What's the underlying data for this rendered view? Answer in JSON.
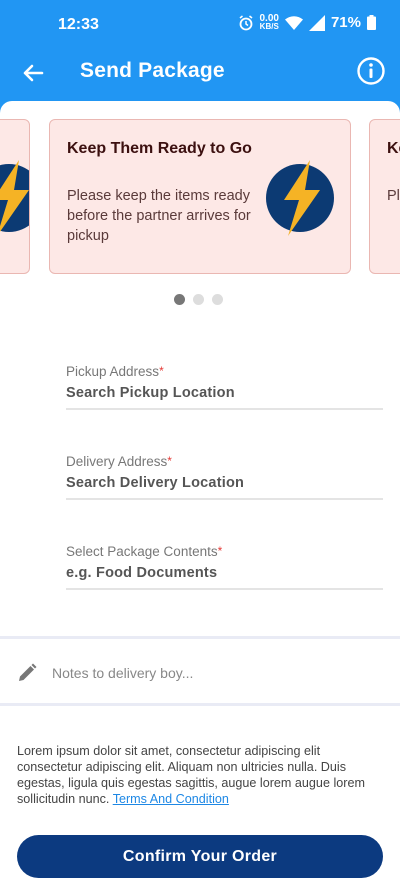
{
  "status_bar": {
    "time": "12:33",
    "speed_value": "0.00",
    "speed_unit": "KB/S",
    "battery": "71%"
  },
  "app_bar": {
    "title": "Send Package"
  },
  "carousel": {
    "cards": [
      {
        "title": "Keep Them Ready to Go",
        "text": "Please keep the items ready before the partner arrives for pickup"
      },
      {
        "title": "Ke Go",
        "text": "Pl re ar"
      }
    ],
    "active_dot": 0,
    "dot_count": 3
  },
  "form": {
    "pickup": {
      "label": "Pickup Address",
      "value": "Search Pickup Location"
    },
    "delivery": {
      "label": "Delivery Address",
      "value": "Search Delivery Location"
    },
    "contents": {
      "label": "Select Package Contents",
      "value": "e.g. Food Documents"
    },
    "required_mark": "*"
  },
  "notes": {
    "placeholder": "Notes to delivery boy..."
  },
  "terms": {
    "text": "Lorem ipsum dolor sit amet, consectetur adipiscing elit consectetur adipiscing elit. Aliquam non ultricies nulla. Duis egestas, ligula quis egestas sagittis, augue lorem augue lorem sollicitudin nunc. ",
    "link": "Terms And Condition"
  },
  "confirm_button": {
    "label": "Confirm Your Order"
  },
  "colors": {
    "primary": "#2196f3",
    "button": "#0c3a80",
    "card_bg": "#fde8e6",
    "bolt_bg": "#0c3a73",
    "bolt": "#f5b325"
  }
}
